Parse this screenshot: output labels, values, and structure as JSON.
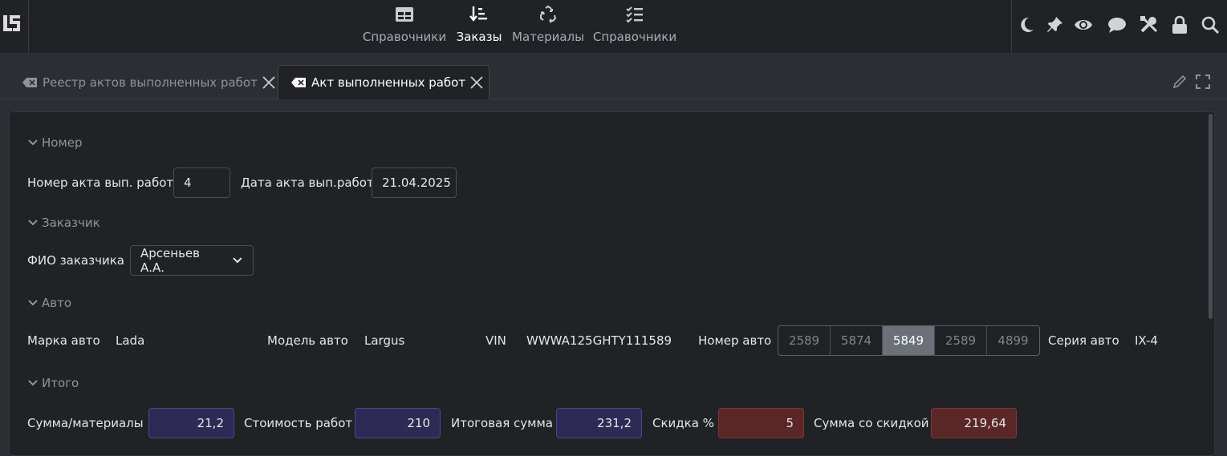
{
  "nav": {
    "items": [
      {
        "label": "Справочники",
        "icon": "table-icon"
      },
      {
        "label": "Заказы",
        "icon": "sort-list-icon"
      },
      {
        "label": "Материалы",
        "icon": "recycle-icon"
      },
      {
        "label": "Справочники",
        "icon": "checklist-icon"
      }
    ],
    "active_index": 1
  },
  "tools": [
    "moon-icon",
    "pin-icon",
    "eye-icon",
    "chat-icon",
    "tools-icon",
    "lock-icon",
    "search-icon"
  ],
  "tabs": [
    {
      "label": "Реестр актов выполненных работ",
      "active": false
    },
    {
      "label": "Акт выполненных работ",
      "active": true
    }
  ],
  "sections": {
    "number": "Номер",
    "customer": "Заказчик",
    "car": "Авто",
    "total": "Итого"
  },
  "act": {
    "number_label": "Номер акта вып. работ",
    "number_value": "4",
    "date_label": "Дата акта вып.работ",
    "date_value": "21.04.2025"
  },
  "customer": {
    "fio_label": "ФИО заказчика",
    "fio_value": "Арсеньев А.А."
  },
  "car": {
    "brand_label": "Марка авто",
    "brand_value": "Lada",
    "model_label": "Модель авто",
    "model_value": "Largus",
    "vin_label": "VIN",
    "vin_value": "WWWA125GHTY111589",
    "plate_label": "Номер авто",
    "plates": [
      "2589",
      "5874",
      "5849",
      "2589",
      "4899"
    ],
    "plate_selected": 2,
    "series_label": "Серия авто",
    "series_value": "IX-4"
  },
  "totals": {
    "materials_label": "Сумма/материалы",
    "materials_value": "21,2",
    "work_label": "Стоимость работ",
    "work_value": "210",
    "total_label": "Итоговая сумма",
    "total_value": "231,2",
    "discount_label": "Скидка %",
    "discount_value": "5",
    "discounted_label": "Сумма со скидкой",
    "discounted_value": "219,64"
  },
  "colors": {
    "topbar": "#202226",
    "background": "#2b2e33",
    "blue_field": "#2d2b55",
    "red_field": "#5a2626",
    "plate_selected": "#6b7079"
  }
}
